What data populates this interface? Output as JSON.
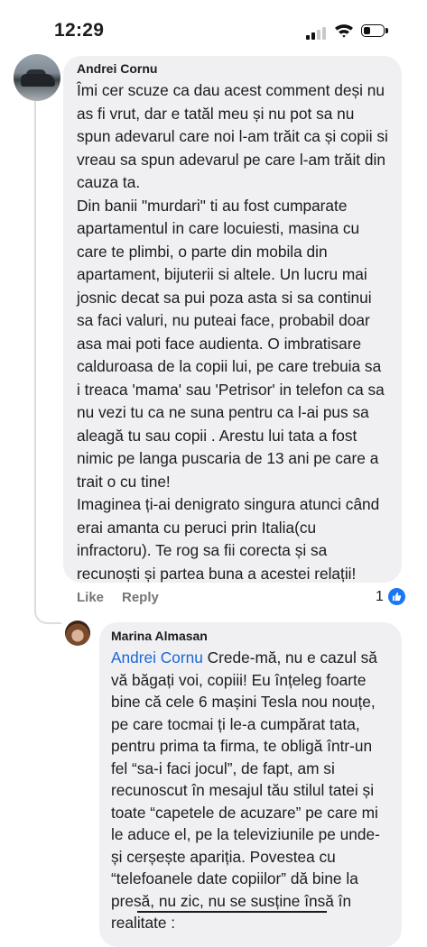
{
  "status_bar": {
    "time": "12:29"
  },
  "comments": [
    {
      "author": "Andrei Cornu",
      "paragraphs": [
        "Îmi cer scuze ca dau acest comment deși nu as fi vrut, dar e tatăl meu și nu pot sa nu spun adevarul care noi l-am trăit ca și copii si vreau sa spun adevarul pe care l-am trăit din cauza ta.",
        "Din banii \"murdari\" ti au fost cumparate apartamentul in care locuiesti, masina cu care te plimbi, o parte din mobila din apartament, bijuterii si altele. Un lucru mai josnic decat sa pui poza asta si sa continui sa faci valuri, nu puteai face, probabil doar asa mai poti face audienta. O imbratisare calduroasa de la copii lui, pe care trebuia sa i treaca 'mama' sau 'Petrisor' in telefon ca sa nu vezi tu ca ne suna pentru ca l-ai pus sa aleagă tu sau copii . Arestu lui tata a fost nimic pe langa puscaria de 13 ani pe care a trait o cu tine!",
        "Imaginea ți-ai denigrato singura atunci când erai amanta cu peruci prin Italia(cu infractoru). Te rog sa fii corecta și sa recunoști și partea buna a acestei relații!"
      ],
      "actions": {
        "like": "Like",
        "reply": "Reply"
      },
      "reaction_count": "1"
    },
    {
      "author": "Marina Almasan",
      "mention": "Andrei Cornu",
      "text": " Crede-mă, nu e cazul să vă băgați voi, copiii! Eu înțeleg foarte bine că cele 6 mașini Tesla nou nouțe, pe care tocmai ți le-a cumpărat tata, pentru prima ta firma, te obligă într-un fel “sa-i faci jocul”, de fapt, am si recunoscut în mesajul tău stilul tatei și toate “capetele de acuzare” pe care mi le aduce el, pe la televiziunile pe unde-și cerșește apariția. Povestea cu “telefoanele date copiilor” dă bine la presă, nu zic, nu se susține însă în realitate :"
    }
  ]
}
